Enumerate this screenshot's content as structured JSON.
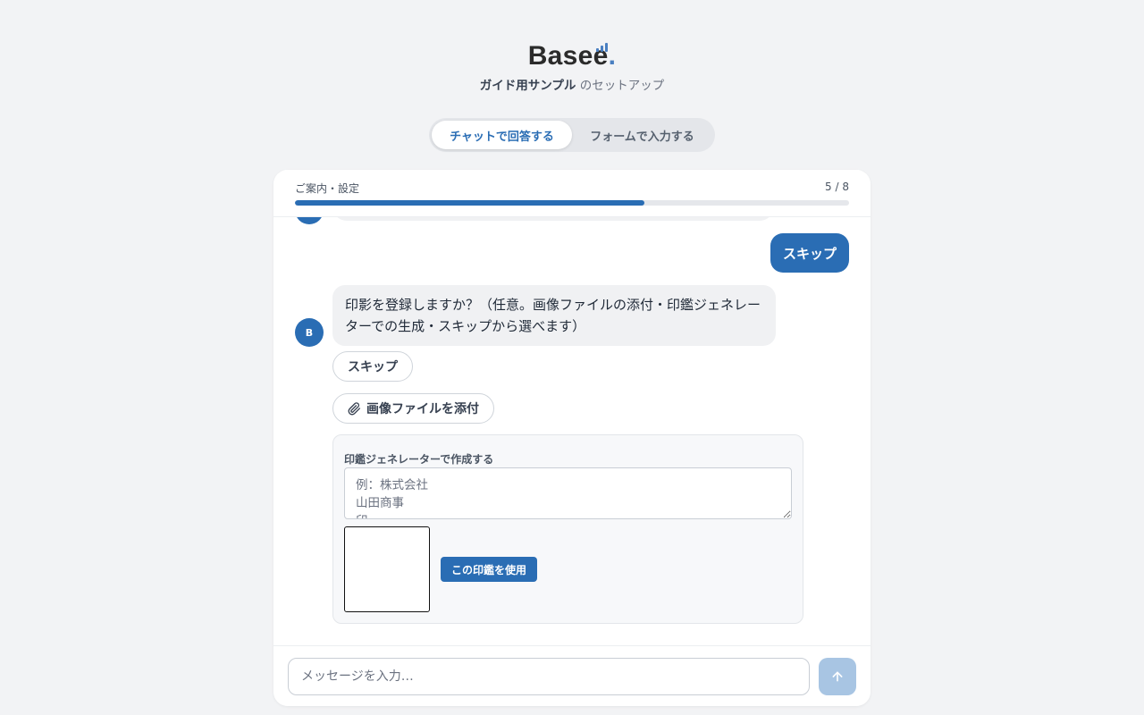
{
  "brand": {
    "logo_text": "Basee",
    "logo_dot": ".",
    "org_name": "ガイド用サンプル",
    "subtitle_suffix": " のセットアップ"
  },
  "mode_toggle": {
    "chat_label": "チャットで回答する",
    "form_label": "フォームで入力する",
    "active": "chat"
  },
  "progress": {
    "section_label": "ご案内・設定",
    "counter": "5 / 8",
    "current": 5,
    "total": 8,
    "fill_fraction": 0.63
  },
  "messages": {
    "user_reply": "スキップ",
    "bot_avatar_letter": "B",
    "bot_question": "印影を登録しますか？（任意。画像ファイルの添付・印鑑ジェネレーターでの生成・スキップから選べます）"
  },
  "actions": {
    "skip_label": "スキップ",
    "attach_label": "画像ファイルを添付"
  },
  "seal_generator": {
    "title": "印鑑ジェネレーターで作成する",
    "placeholder": "例：株式会社\n山田商事\n印",
    "use_button_label": "この印鑑を使用"
  },
  "composer": {
    "placeholder": "メッセージを入力…"
  },
  "icons": {
    "attach": "paperclip-icon",
    "send": "arrow-up-icon"
  },
  "colors": {
    "accent": "#2a6db4",
    "send_disabled": "#a8c5e3",
    "bubble_bg": "#f0f1f3",
    "page_bg": "#f2f3f5"
  }
}
